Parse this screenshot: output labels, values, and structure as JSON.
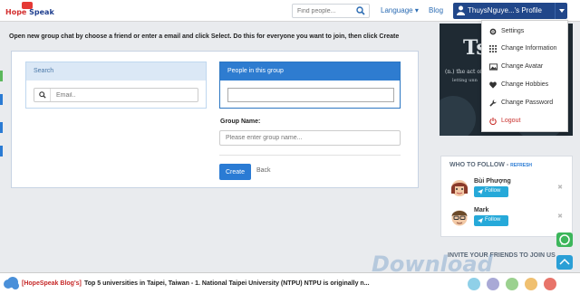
{
  "navbar": {
    "logo_top": "Hope",
    "logo_bottom": "Speak",
    "find_placeholder": "Find people...",
    "language_label": "Language",
    "blog_label": "Blog",
    "profile_label": "ThuysNguye...'s Profile"
  },
  "instruction": "Open new group chat by choose a friend or enter a email and click Select. Do this for everyone you want to join, then click Create",
  "search_panel": {
    "title": "Search",
    "email_placeholder": "Email.."
  },
  "people_panel": {
    "title": "People in this group"
  },
  "group_form": {
    "label": "Group Name:",
    "placeholder": "Please enter group name...",
    "create_label": "Create",
    "back_label": "Back"
  },
  "banner": {
    "big_text": "Ts",
    "line1": "(n.) the act of bu",
    "line2": "letting unn"
  },
  "profile_menu": {
    "items": [
      {
        "label": "Settings",
        "icon": "gear-icon"
      },
      {
        "label": "Change Information",
        "icon": "grid-icon"
      },
      {
        "label": "Change Avatar",
        "icon": "picture-icon"
      },
      {
        "label": "Change Hobbies",
        "icon": "heart-icon"
      },
      {
        "label": "Change Password",
        "icon": "wrench-icon"
      },
      {
        "label": "Logout",
        "icon": "power-icon"
      }
    ]
  },
  "who_to_follow": {
    "title": "WHO TO FOLLOW",
    "refresh": "REFRESH",
    "people": [
      {
        "name": "Bùi Phượng",
        "button": "Follow"
      },
      {
        "name": "Mark",
        "button": "Follow"
      }
    ]
  },
  "invite": "INVITE YOUR FRIENDS TO JOIN US",
  "ticker": {
    "tag": "[HopeSpeak Blog's]",
    "text": "Top 5 universities in Taipei, Taiwan - 1. National Taipei University (NTPU)  NTPU is originally n..."
  },
  "watermark": "Download",
  "colors": {
    "primary": "#2a7bd4",
    "profile_bg": "#21478a",
    "follow_btn": "#26a9d9",
    "logout": "#c9302c"
  }
}
